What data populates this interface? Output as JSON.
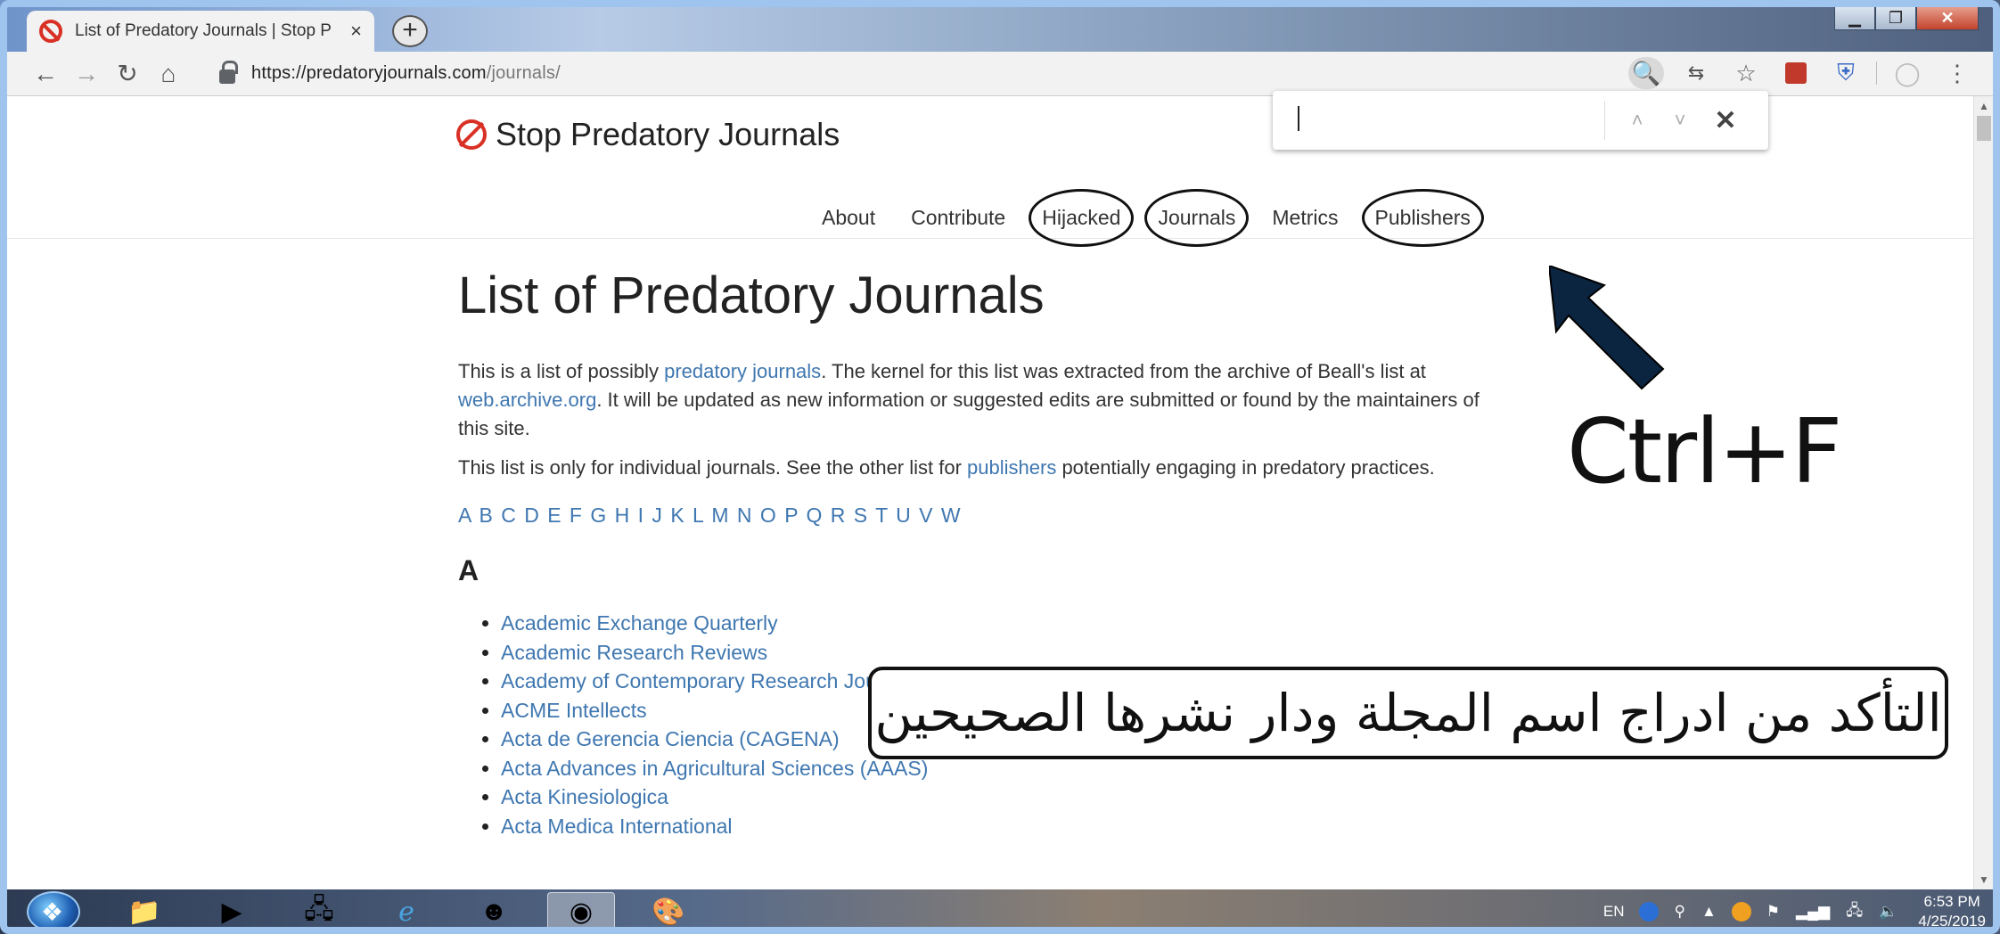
{
  "browser": {
    "tab_title": "List of Predatory Journals | Stop P",
    "tab_close": "×",
    "new_tab": "+",
    "url_host": "https://predatoryjournals.com",
    "url_path": "/journals/",
    "find_value": "",
    "find_prev": "˄",
    "find_next": "˅",
    "find_close": "✕"
  },
  "site": {
    "logo_text": "Stop Predatory Journals",
    "nav": [
      "About",
      "Contribute",
      "Hijacked",
      "Journals",
      "Metrics",
      "Publishers"
    ],
    "title": "List of Predatory Journals",
    "intro": {
      "t1": "This is a list of possibly ",
      "link1": "predatory journals",
      "t2": ". The kernel for this list was extracted from the archive of Beall's list at ",
      "link2": "web.archive.org",
      "t3": ". It will be updated as new information or suggested edits are submitted or found by the maintainers of this site."
    },
    "note": {
      "t1": "This list is only for individual journals. See the other list for ",
      "link": "publishers",
      "t2": " potentially engaging in predatory practices."
    },
    "alphabet": "A B C D E F G H I J K L M N O P Q R S T U V W",
    "section": "A",
    "journals": [
      "Academic Exchange Quarterly",
      "Academic Research Reviews",
      "Academy of Contemporary Research Journal (AOCRJ)",
      "ACME Intellects",
      "Acta  de Gerencia Ciencia (CAGENA)",
      "Acta Advances in Agricultural Sciences (AAAS)",
      "Acta Kinesiologica",
      "Acta Medica International"
    ]
  },
  "annotations": {
    "shortcut": "Ctrl+F",
    "arabic_note": "التأكد من ادراج اسم المجلة ودار نشرها الصحيحين"
  },
  "taskbar": {
    "language": "EN",
    "time": "6:53 PM",
    "date": "4/25/2019"
  },
  "colors": {
    "link": "#3f77b0",
    "brand_red": "#d93025"
  }
}
